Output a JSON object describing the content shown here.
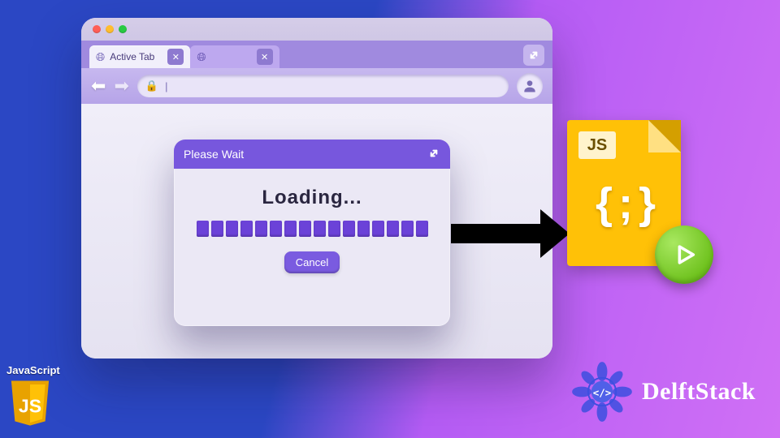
{
  "browser": {
    "tabs": [
      {
        "label": "Active Tab",
        "active": true
      },
      {
        "label": "",
        "active": false
      }
    ],
    "address_placeholder": "|",
    "expand_icon": "expand-icon"
  },
  "dialog": {
    "title": "Please Wait",
    "loading_text": "Loading...",
    "cancel_label": "Cancel",
    "segments": 16
  },
  "jsfile": {
    "label": "JS",
    "code_glyph": "{ ; }"
  },
  "jslogo": {
    "caption": "JavaScript",
    "badge": "JS"
  },
  "brand": {
    "name": "DelftStack"
  },
  "colors": {
    "accent": "#7757dd",
    "progress": "#6b42d8",
    "js_yellow": "#ffc107",
    "play_green": "#6fc21e"
  }
}
